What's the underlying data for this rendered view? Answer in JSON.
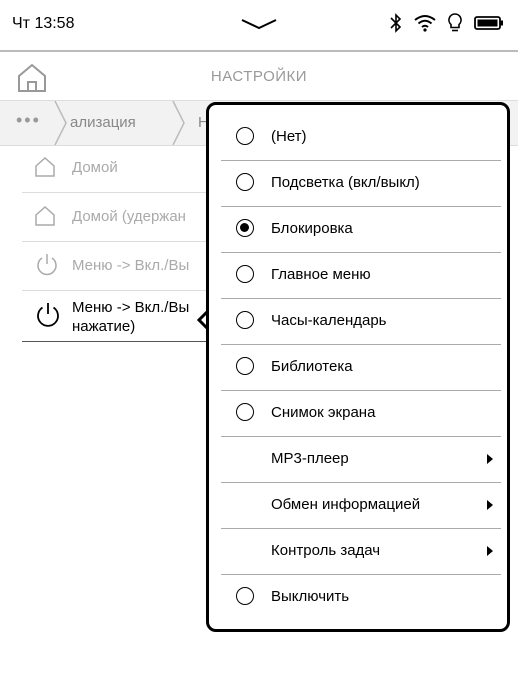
{
  "status": {
    "time": "Чт 13:58",
    "icons": [
      "bluetooth-icon",
      "wifi-icon",
      "light-icon",
      "battery-icon"
    ]
  },
  "header": {
    "title": "НАСТРОЙКИ"
  },
  "breadcrumb": {
    "more": "•••",
    "items": [
      "ализация",
      "Н"
    ]
  },
  "list": [
    {
      "icon": "home-icon",
      "label": "Домой"
    },
    {
      "icon": "home-icon",
      "label": "Домой (удержан"
    },
    {
      "icon": "power-icon",
      "label": "Меню -> Вкл./Вы"
    },
    {
      "icon": "power-icon",
      "label": "Меню -> Вкл./Вы нажатие)"
    }
  ],
  "popup": {
    "options": [
      {
        "label": "(Нет)",
        "type": "radio",
        "checked": false
      },
      {
        "label": "Подсветка (вкл/выкл)",
        "type": "radio",
        "checked": false
      },
      {
        "label": "Блокировка",
        "type": "radio",
        "checked": true
      },
      {
        "label": "Главное меню",
        "type": "radio",
        "checked": false
      },
      {
        "label": "Часы-календарь",
        "type": "radio",
        "checked": false
      },
      {
        "label": "Библиотека",
        "type": "radio",
        "checked": false
      },
      {
        "label": "Снимок экрана",
        "type": "radio",
        "checked": false
      },
      {
        "label": "MP3-плеер",
        "type": "submenu"
      },
      {
        "label": "Обмен информацией",
        "type": "submenu"
      },
      {
        "label": "Контроль задач",
        "type": "submenu"
      },
      {
        "label": "Выключить",
        "type": "radio",
        "checked": false
      }
    ]
  }
}
